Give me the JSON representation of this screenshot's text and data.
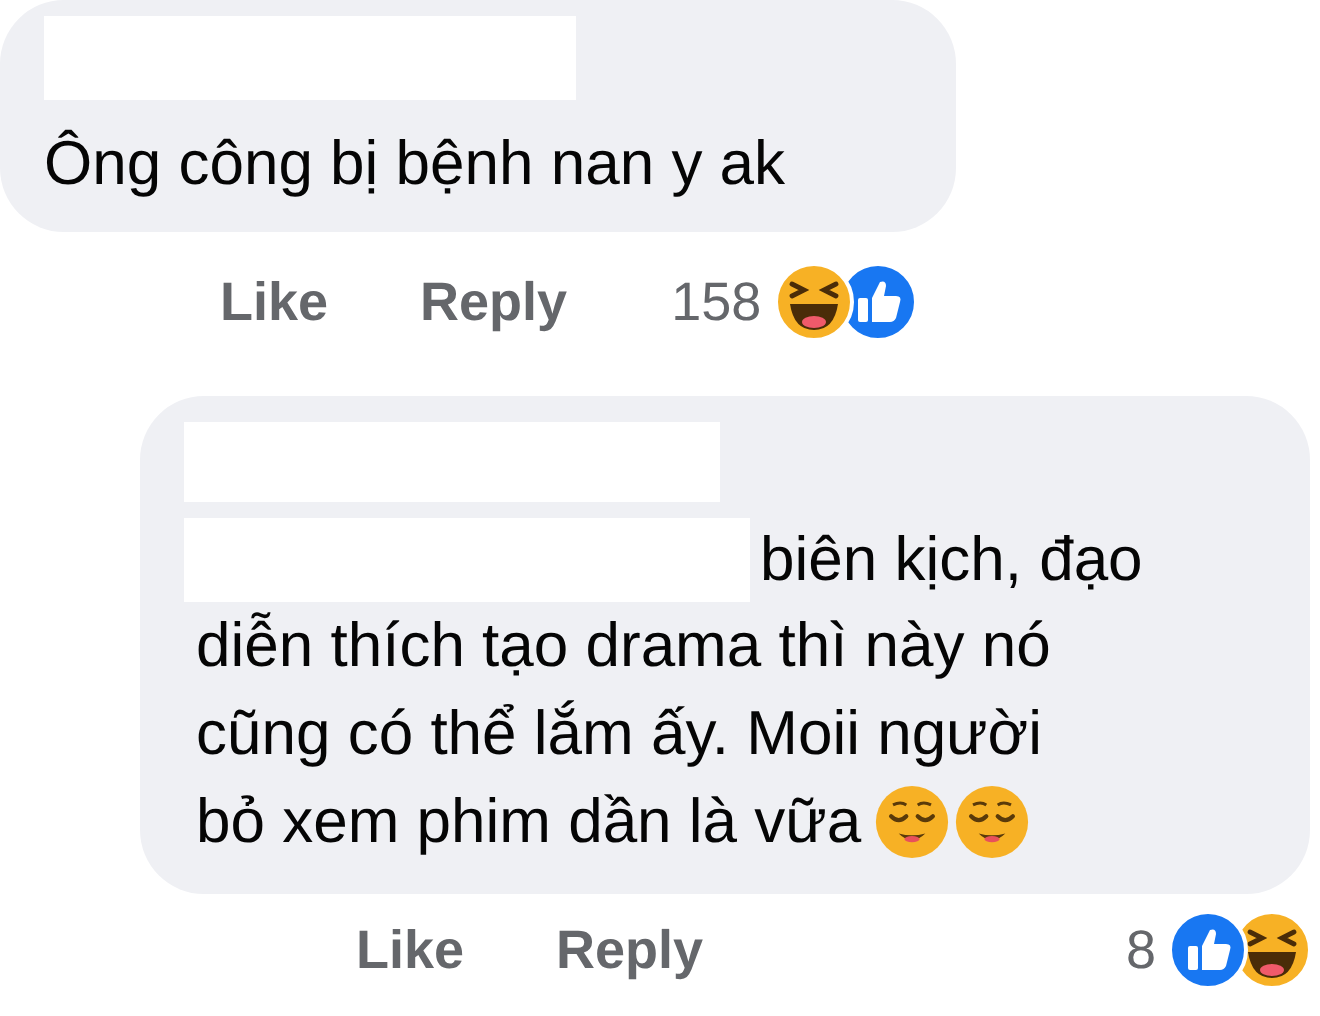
{
  "comments": [
    {
      "kind": "comment",
      "text": "Ông công bị bệnh nan y ak",
      "actions": [
        "Like",
        "Reply"
      ],
      "reaction_count": "158",
      "reactions": [
        {
          "kind": "haha"
        },
        {
          "kind": "like"
        }
      ]
    },
    {
      "kind": "reply",
      "text_lead": "biên kịch, đạo",
      "text": "diễn thích tạo drama thì này nó cũng có thể lắm ấy. Moii người",
      "text_tail": "bỏ xem phim dần là vữa",
      "inline_emojis": [
        {
          "kind": "relieved"
        },
        {
          "kind": "relieved"
        }
      ],
      "actions": [
        "Like",
        "Reply"
      ],
      "reaction_count": "8",
      "reactions": [
        {
          "kind": "like"
        },
        {
          "kind": "haha"
        }
      ]
    }
  ]
}
